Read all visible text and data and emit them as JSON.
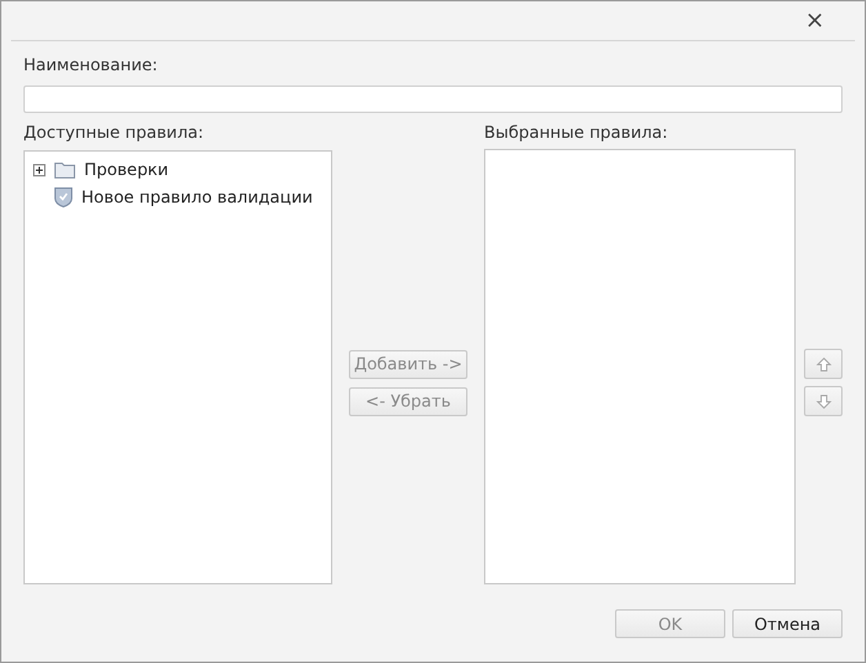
{
  "window": {
    "close": "×"
  },
  "name_field": {
    "label": "Наименование:"
  },
  "available": {
    "label": "Доступные правила:",
    "items": [
      {
        "kind": "folder",
        "label": "Проверки",
        "expanded": false
      },
      {
        "kind": "rule",
        "label": "Новое правило валидации"
      }
    ]
  },
  "transfer_buttons": [
    {
      "label": "Добавить ->",
      "disabled": true
    },
    {
      "label": "<- Убрать",
      "disabled": true
    }
  ],
  "selected": {
    "label": "Выбранные правила:"
  },
  "order_buttons": [
    {
      "kind": "up",
      "disabled": true
    },
    {
      "kind": "down",
      "disabled": true
    }
  ],
  "buttons": [
    {
      "label": "OK",
      "disabled": true
    },
    {
      "label": "Отмена",
      "disabled": false
    }
  ]
}
